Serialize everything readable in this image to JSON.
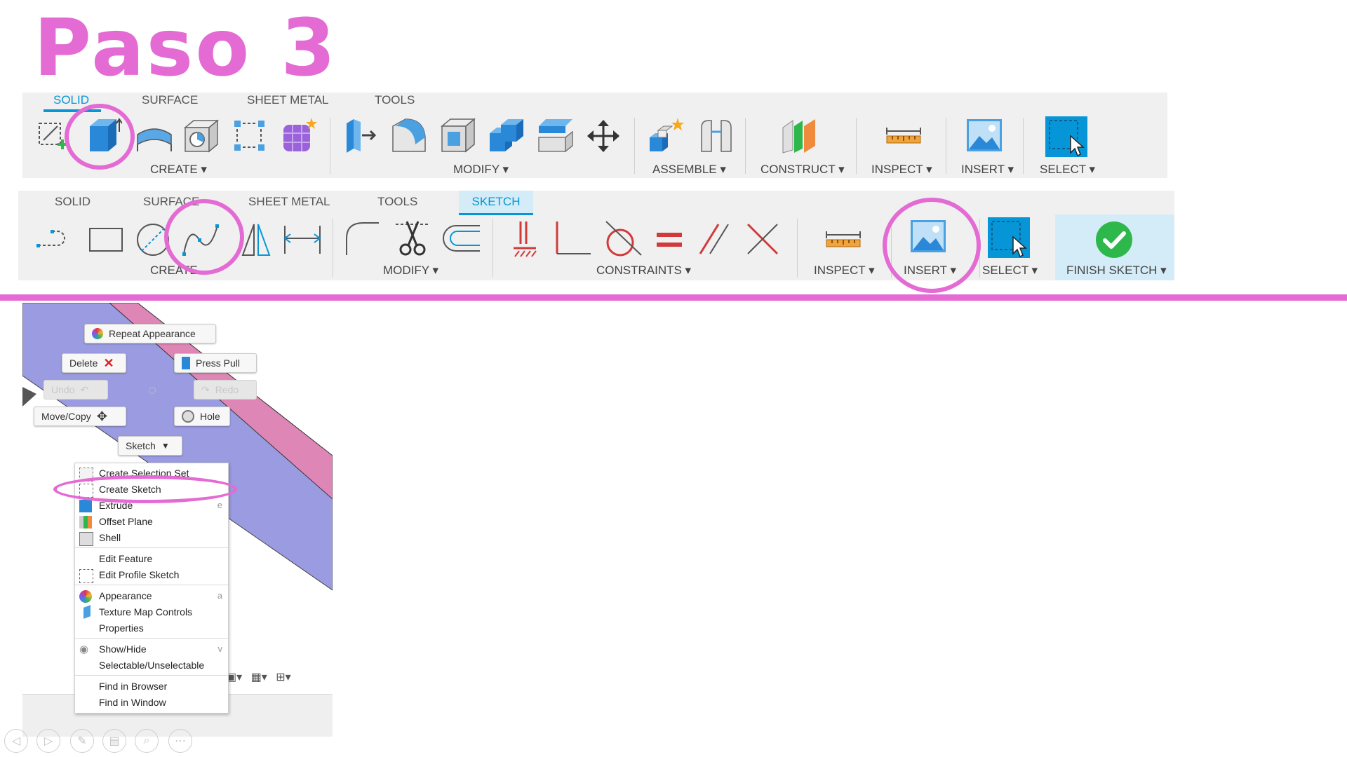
{
  "title": "Paso 3",
  "toolbar1": {
    "tabs": [
      "SOLID",
      "SURFACE",
      "SHEET METAL",
      "TOOLS"
    ],
    "active_tab": "SOLID",
    "groups": [
      "CREATE ▾",
      "MODIFY ▾",
      "ASSEMBLE ▾",
      "CONSTRUCT ▾",
      "INSPECT ▾",
      "INSERT ▾",
      "SELECT ▾"
    ]
  },
  "toolbar2": {
    "tabs": [
      "SOLID",
      "SURFACE",
      "SHEET METAL",
      "TOOLS",
      "SKETCH"
    ],
    "active_tab": "SKETCH",
    "groups": [
      "CREATE",
      "MODIFY ▾",
      "CONSTRAINTS ▾",
      "INSPECT ▾",
      "INSERT ▾",
      "SELECT ▾",
      "FINISH SKETCH ▾"
    ]
  },
  "marking_menu": {
    "repeat_appearance": "Repeat Appearance",
    "delete": "Delete",
    "press_pull": "Press Pull",
    "undo": "Undo",
    "redo": "Redo",
    "move_copy": "Move/Copy",
    "hole": "Hole",
    "sketch": "Sketch"
  },
  "context_menu": {
    "items": [
      {
        "label": "Create Selection Set",
        "shortcut": ""
      },
      {
        "label": "Create Sketch",
        "shortcut": ""
      },
      {
        "label": "Extrude",
        "shortcut": "e"
      },
      {
        "label": "Offset Plane",
        "shortcut": ""
      },
      {
        "label": "Shell",
        "shortcut": ""
      },
      {
        "label": "Edit Feature",
        "shortcut": ""
      },
      {
        "label": "Edit Profile Sketch",
        "shortcut": ""
      },
      {
        "label": "Appearance",
        "shortcut": "a"
      },
      {
        "label": "Texture Map Controls",
        "shortcut": ""
      },
      {
        "label": "Properties",
        "shortcut": ""
      },
      {
        "label": "Show/Hide",
        "shortcut": "v"
      },
      {
        "label": "Selectable/Unselectable",
        "shortcut": ""
      },
      {
        "label": "Find in Browser",
        "shortcut": ""
      },
      {
        "label": "Find in Window",
        "shortcut": ""
      }
    ]
  },
  "colors": {
    "accent_pink": "#e46ad4",
    "fusion_blue": "#0696d7",
    "model_purple": "#9a9be0",
    "model_pink": "#de86b5",
    "finish_green": "#2eb84b"
  }
}
